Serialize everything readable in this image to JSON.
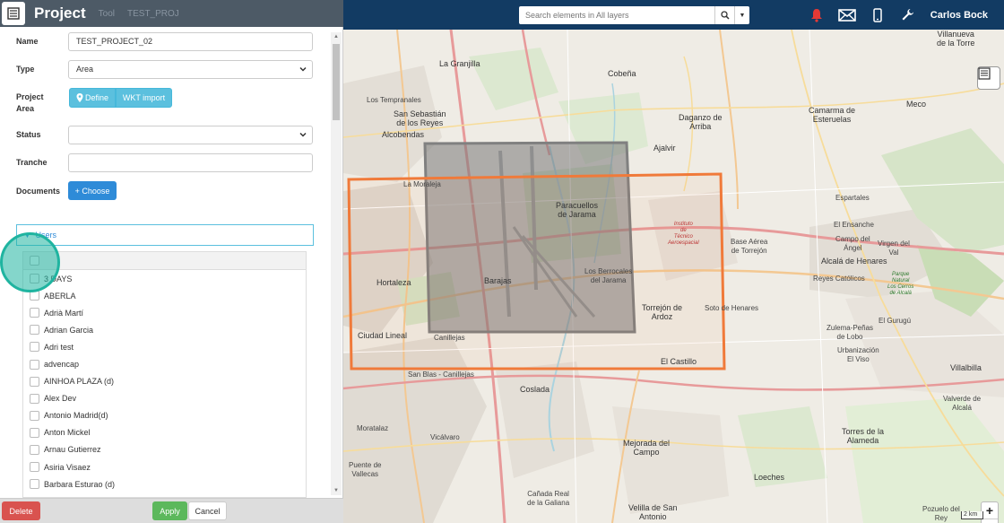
{
  "header": {
    "panel_title": "Project",
    "faded_text_1": "Tool",
    "faded_text_2": "TEST_PROJ"
  },
  "search": {
    "placeholder": "Search elements in All layers"
  },
  "user": {
    "name": "Carlos Bock"
  },
  "form": {
    "name_label": "Name",
    "name_value": "TEST_PROJECT_02",
    "type_label": "Type",
    "type_value": "Area",
    "area_label_1": "Project",
    "area_label_2": "Area",
    "define_label": "Define",
    "wkt_label": "WKT import",
    "status_label": "Status",
    "status_value": "",
    "tranche_label": "Tranche",
    "tranche_value": "",
    "documents_label": "Documents",
    "choose_label": "+ Choose"
  },
  "users": {
    "header_label": "Users",
    "items": [
      "3 DAYS",
      "ABERLA",
      "Adrià Martí",
      "Adrian Garcia",
      "Adri test",
      "advencap",
      "AINHOA PLAZA (d)",
      "Alex Dev",
      "Antonio Madrid(d)",
      "Anton Mickel",
      "Arnau Gutierrez",
      "Asiria Visaez",
      "Barbara Esturao (d)"
    ]
  },
  "footer": {
    "delete_label": "Delete",
    "apply_label": "Apply",
    "cancel_label": "Cancel"
  },
  "map": {
    "labels": {
      "villanueva": "Villanueva\nde la Torre",
      "granjilla": "La Granjilla",
      "cobena": "Cobeña",
      "ssreyes": "San Sebastián\nde los Reyes",
      "alcobendas": "Alcobendas",
      "temprnales": "Los Tempranales",
      "daganzo": "Daganzo de\nArriba",
      "camarma": "Camarma de\nEsteruelas",
      "meco": "Meco",
      "ajalvir": "Ajalvir",
      "moraleja": "La Moraleja",
      "paracuellos": "Paracuellos\nde Jarama",
      "instituto": "Instituto\nde\nTécnico\nAeroespacial",
      "base": "Base Aérea\nde Torrejón",
      "espartales": "Espartales",
      "ensanche": "El Ensanche",
      "campoangel": "Campo del\nÁngel",
      "virgenval": "Virgen del\nVal",
      "alcala": "Alcalá de Henares",
      "catolicos": "Reyes Católicos",
      "parque": "Parque\nNatural\nLos Cerros\nde Alcalá",
      "hortaleza": "Hortaleza",
      "barajas": "Barajas",
      "berrocales": "Los Berrocales\ndel Jarama",
      "torrejon": "Torrejón de\nArdoz",
      "sotohenares": "Soto de Henares",
      "gurugu": "El Gurugú",
      "zulema": "Zulema-Peñas\nde Lobo",
      "urbanizacion": "Urbanización\nEl Viso",
      "ciudadlineal": "Ciudad Lineal",
      "canillejas": "Canillejas",
      "castillo": "El Castillo",
      "villalbilla": "Villalbilla",
      "sanblas": "San Blas - Canillejas",
      "coslada": "Coslada",
      "valverde": "Valverde de\nAlcalá",
      "moratalaz": "Moratalaz",
      "vicalvaro": "Vicálvaro",
      "mejorada": "Mejorada del\nCampo",
      "torres": "Torres de la\nAlameda",
      "puente": "Puente de\nVallecas",
      "loeches": "Loeches",
      "canada": "Cañada Real\nde la Galiana",
      "velilla": "Velilla de San\nAntonio",
      "pozuelo": "Pozuelo del\nRey"
    },
    "scale_label": "2 km",
    "zoom_in": "+",
    "zoom_out": "−",
    "gray_area_color": "#808080",
    "project_area_color": "#f07a3a"
  },
  "colors": {
    "topbar": "#123b63",
    "info_button": "#5bc0de",
    "primary_button": "#2e8bd8",
    "delete_button": "#d9534f",
    "apply_button": "#5cb85c",
    "highlight": "#1fb4a0"
  }
}
